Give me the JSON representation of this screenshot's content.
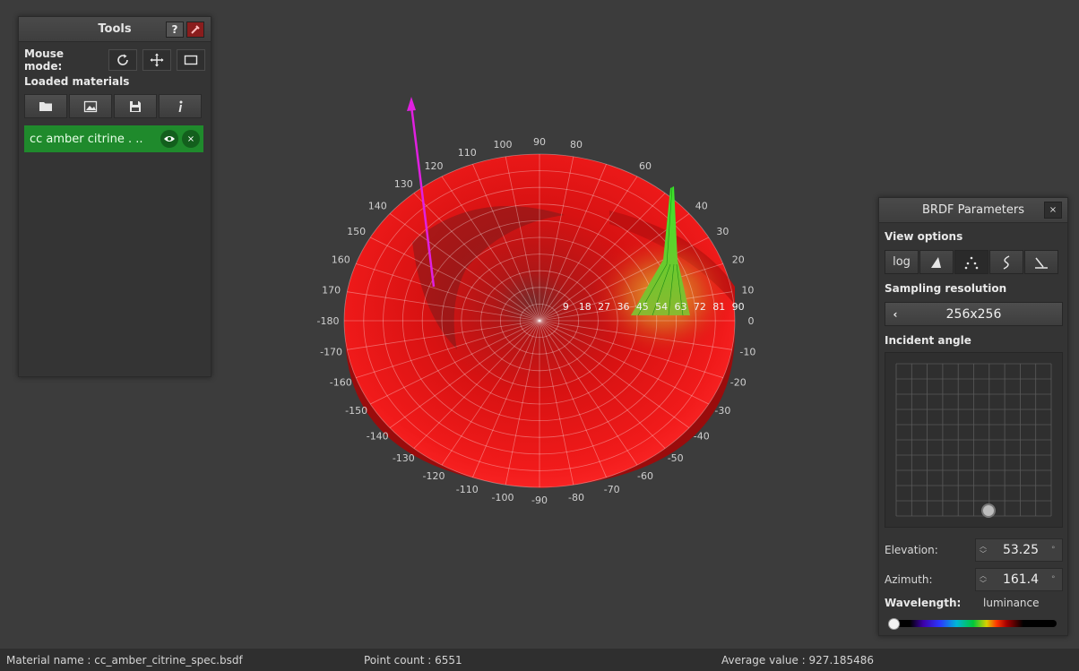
{
  "tools": {
    "title": "Tools",
    "help_label": "?",
    "mouse_mode_label": "Mouse mode:",
    "loaded_materials_label": "Loaded materials",
    "material_name": "cc amber citrine . ..",
    "material_hide_label": "×"
  },
  "viewport": {
    "tick_labels_outer": [
      "90",
      "100",
      "110",
      "120",
      "130",
      "140",
      "150",
      "160",
      "170",
      "-180",
      "-170",
      "-160",
      "-150",
      "-140",
      "-130",
      "-120",
      "-110",
      "-100",
      "-90",
      "-80",
      "-70",
      "-60",
      "-50",
      "-40",
      "-30",
      "-20",
      "-10",
      "0",
      "10",
      "20",
      "30",
      "40",
      "60",
      "80"
    ],
    "tick_labels_radial": [
      "9",
      "18",
      "27",
      "36",
      "45",
      "54",
      "63",
      "72",
      "81",
      "90"
    ]
  },
  "brdf": {
    "title": "BRDF Parameters",
    "close_label": "×",
    "view_options_label": "View options",
    "log_label": "log",
    "sampling_label": "Sampling resolution",
    "resolution_value": "256x256",
    "incident_label": "Incident angle",
    "elevation_label": "Elevation:",
    "elevation_value": "53.25",
    "azimuth_label": "Azimuth:",
    "azimuth_value": "161.4",
    "wavelength_label": "Wavelength:",
    "wavelength_value": "luminance"
  },
  "status": {
    "material_name": "Material name :  cc_amber_citrine_spec.bsdf",
    "point_count": "Point count :  6551",
    "average_value": "Average value :  927.185486"
  },
  "colors": {
    "background": "#3c3c3c",
    "material_item": "#1f8a2c",
    "surface_red": "#e81010",
    "peak_green": "#39d62a",
    "incident_arrow": "#e020e0"
  }
}
